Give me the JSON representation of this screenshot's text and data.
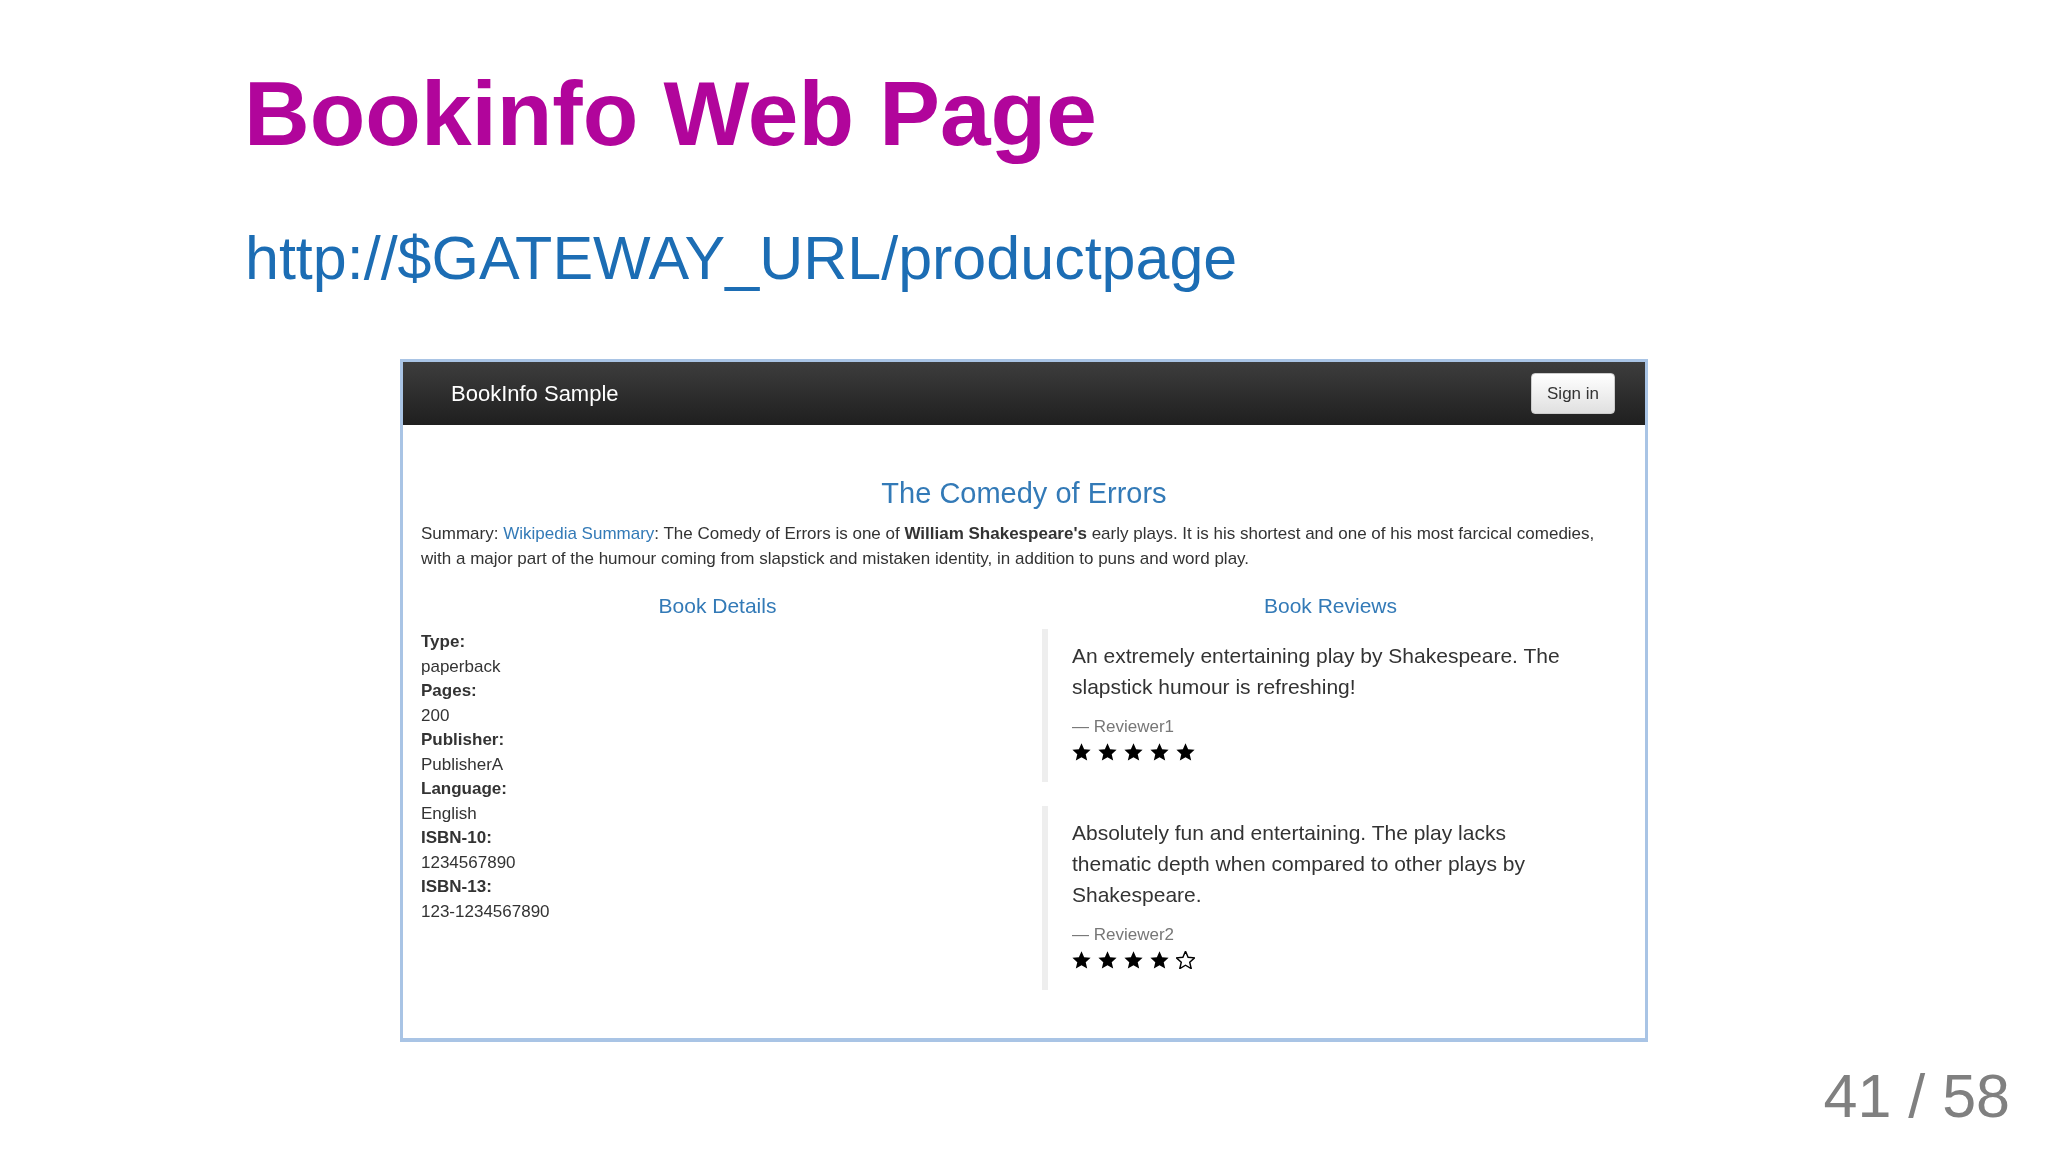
{
  "slide": {
    "title": "Bookinfo Web Page",
    "url": "http://$GATEWAY_URL/productpage"
  },
  "screenshot": {
    "navbar": {
      "brand": "BookInfo Sample",
      "sign_in_button": "Sign in"
    },
    "book_title": "The Comedy of Errors",
    "summary": {
      "label": "Summary:",
      "link": "Wikipedia Summary",
      "text": ": The Comedy of Errors is one of **William Shakespeare's** early plays. It is his shortest and one of his most farcical comedies, with a major part of the humour coming from slapstick and mistaken identity, in addition to puns and word play."
    },
    "book_details": {
      "heading": "Book Details",
      "fields": [
        {
          "label": "Type:",
          "value": "paperback"
        },
        {
          "label": "Pages:",
          "value": "200"
        },
        {
          "label": "Publisher:",
          "value": "PublisherA"
        },
        {
          "label": "Language:",
          "value": "English"
        },
        {
          "label": "ISBN-10:",
          "value": "1234567890"
        },
        {
          "label": "ISBN-13:",
          "value": "123-1234567890"
        }
      ]
    },
    "book_reviews": {
      "heading": "Book Reviews",
      "reviews": [
        {
          "text": "An extremely entertaining play by Shakespeare. The slapstick humour is refreshing!",
          "reviewer": "— Reviewer1",
          "stars": 5
        },
        {
          "text": "Absolutely fun and entertaining. The play lacks thematic depth when compared to other plays by Shakespeare.",
          "reviewer": "— Reviewer2",
          "stars": 4
        }
      ]
    }
  },
  "page_number": "41 / 58"
}
